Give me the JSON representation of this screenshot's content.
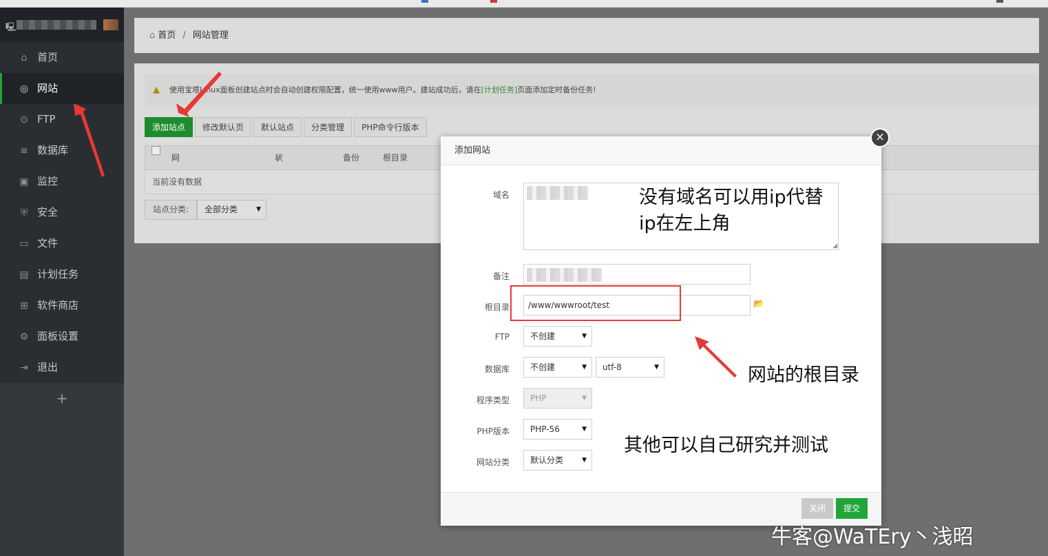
{
  "sidebar": {
    "items": [
      {
        "label": "首页",
        "icon": "home-icon"
      },
      {
        "label": "网站",
        "icon": "globe-icon",
        "active": true
      },
      {
        "label": "FTP",
        "icon": "ftp-icon"
      },
      {
        "label": "数据库",
        "icon": "database-icon"
      },
      {
        "label": "监控",
        "icon": "monitor-icon"
      },
      {
        "label": "安全",
        "icon": "shield-icon"
      },
      {
        "label": "文件",
        "icon": "folder-icon"
      },
      {
        "label": "计划任务",
        "icon": "calendar-icon"
      },
      {
        "label": "软件商店",
        "icon": "grid-icon"
      },
      {
        "label": "面板设置",
        "icon": "gear-icon"
      },
      {
        "label": "退出",
        "icon": "logout-icon"
      }
    ],
    "add_label": "+"
  },
  "breadcrumb": {
    "home": "首页",
    "sep": "/",
    "current": "网站管理"
  },
  "notice": {
    "text_before": "使用宝塔Linux面板创建站点时会自动创建权限配置，统一使用www用户。建站成功后，请在",
    "link": "[计划任务]",
    "text_after": "页面添加定时备份任务!"
  },
  "toolbar": {
    "add_site": "添加站点",
    "edit_default": "修改默认页",
    "default_site": "默认站点",
    "category_mgmt": "分类管理",
    "php_cli": "PHP命令行版本"
  },
  "table": {
    "headers": {
      "name": "网站名",
      "status": "状态",
      "backup": "备份",
      "root": "根目录"
    },
    "empty": "当前没有数据"
  },
  "category_filter": {
    "label": "站点分类:",
    "value": "全部分类"
  },
  "modal": {
    "title": "添加网站",
    "close": "×",
    "labels": {
      "domain": "域名",
      "remark": "备注",
      "root": "根目录",
      "ftp": "FTP",
      "database": "数据库",
      "program_type": "程序类型",
      "php_version": "PHP版本",
      "site_category": "网站分类"
    },
    "values": {
      "root": "/www/wwwroot/test",
      "ftp": "不创建",
      "database": "不创建",
      "charset": "utf-8",
      "program_type": "PHP",
      "php_version": "PHP-56",
      "site_category": "默认分类"
    },
    "buttons": {
      "close": "关闭",
      "submit": "提交"
    }
  },
  "annotations": {
    "domain_hint_line1": "没有域名可以用ip代替",
    "domain_hint_line2": "ip在左上角",
    "root_hint": "网站的根目录",
    "other_hint": "其他可以自己研究并测试"
  },
  "watermark": "牛客@WaTEry丶浅昭",
  "colors": {
    "brand_green": "#20a53a",
    "annotation_red": "#e53935",
    "sidebar_bg": "#2a2d31"
  }
}
